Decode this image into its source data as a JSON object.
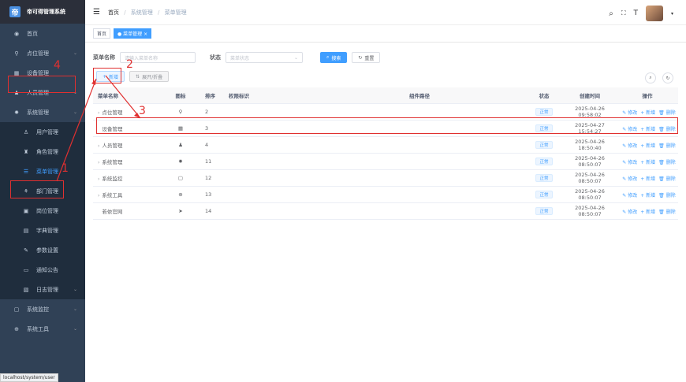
{
  "app": {
    "title": "帝可得管理系统"
  },
  "sidebar": {
    "items": [
      {
        "label": "首页",
        "icon": "dashboard-icon",
        "arrow": false,
        "sub": false
      },
      {
        "label": "点位管理",
        "icon": "location-icon",
        "arrow": true,
        "sub": false
      },
      {
        "label": "设备管理",
        "icon": "device-icon",
        "arrow": false,
        "sub": false
      },
      {
        "label": "人员管理",
        "icon": "people-icon",
        "arrow": true,
        "sub": false
      },
      {
        "label": "系统管理",
        "icon": "gear-icon",
        "arrow": true,
        "sub": false
      },
      {
        "label": "用户管理",
        "icon": "user-icon",
        "arrow": false,
        "sub": true
      },
      {
        "label": "角色管理",
        "icon": "role-icon",
        "arrow": false,
        "sub": true
      },
      {
        "label": "菜单管理",
        "icon": "tree-icon",
        "arrow": false,
        "sub": true,
        "active": true
      },
      {
        "label": "部门管理",
        "icon": "org-icon",
        "arrow": false,
        "sub": true
      },
      {
        "label": "岗位管理",
        "icon": "post-icon",
        "arrow": false,
        "sub": true
      },
      {
        "label": "字典管理",
        "icon": "dict-icon",
        "arrow": false,
        "sub": true
      },
      {
        "label": "参数设置",
        "icon": "edit-icon",
        "arrow": false,
        "sub": true
      },
      {
        "label": "通知公告",
        "icon": "message-icon",
        "arrow": false,
        "sub": true
      },
      {
        "label": "日志管理",
        "icon": "log-icon",
        "arrow": true,
        "sub": true
      },
      {
        "label": "系统监控",
        "icon": "monitor-icon",
        "arrow": true,
        "sub": false
      },
      {
        "label": "系统工具",
        "icon": "tool-icon",
        "arrow": true,
        "sub": false
      }
    ],
    "status_tip": "localhost/system/user"
  },
  "header": {
    "breadcrumb": [
      "首页",
      "系统管理",
      "菜单管理"
    ]
  },
  "tags": [
    {
      "label": "首页",
      "active": false
    },
    {
      "label": "● 菜单管理 ×",
      "active": true
    }
  ],
  "search": {
    "name_label": "菜单名称",
    "name_placeholder": "请输入菜单名称",
    "status_label": "状态",
    "status_placeholder": "菜单状态",
    "search_button": "搜索",
    "reset_button": "重置"
  },
  "toolbar": {
    "add_button": "新增",
    "expand_button": "展开/折叠"
  },
  "table": {
    "headers": [
      "菜单名称",
      "图标",
      "排序",
      "权限标识",
      "组件路径",
      "状态",
      "创建时间",
      "操作"
    ],
    "op_labels": {
      "edit": "修改",
      "add": "新增",
      "delete": "删除"
    },
    "rows": [
      {
        "name": "点位管理",
        "icon": "location-icon",
        "order": "2",
        "status": "正常",
        "created": "2025-04-26 09:58:02",
        "expand": true
      },
      {
        "name": "设备管理",
        "icon": "device-icon",
        "order": "3",
        "status": "正常",
        "created": "2025-04-27 15:54:27",
        "expand": false
      },
      {
        "name": "人员管理",
        "icon": "people-icon",
        "order": "4",
        "status": "正常",
        "created": "2025-04-26 18:50:40",
        "expand": true
      },
      {
        "name": "系统管理",
        "icon": "gear-icon",
        "order": "11",
        "status": "正常",
        "created": "2025-04-26 08:50:07",
        "expand": true
      },
      {
        "name": "系统监控",
        "icon": "monitor-icon",
        "order": "12",
        "status": "正常",
        "created": "2025-04-26 08:50:07",
        "expand": true
      },
      {
        "name": "系统工具",
        "icon": "tool-icon",
        "order": "13",
        "status": "正常",
        "created": "2025-04-26 08:50:07",
        "expand": true
      },
      {
        "name": "若依官网",
        "icon": "send-icon",
        "order": "14",
        "status": "正常",
        "created": "2025-04-26 08:50:07",
        "expand": false
      }
    ]
  },
  "annotations": [
    "1",
    "2",
    "3",
    "4"
  ],
  "colors": {
    "accent": "#409eff",
    "sidebar": "#304156",
    "annotation": "#e03030"
  }
}
